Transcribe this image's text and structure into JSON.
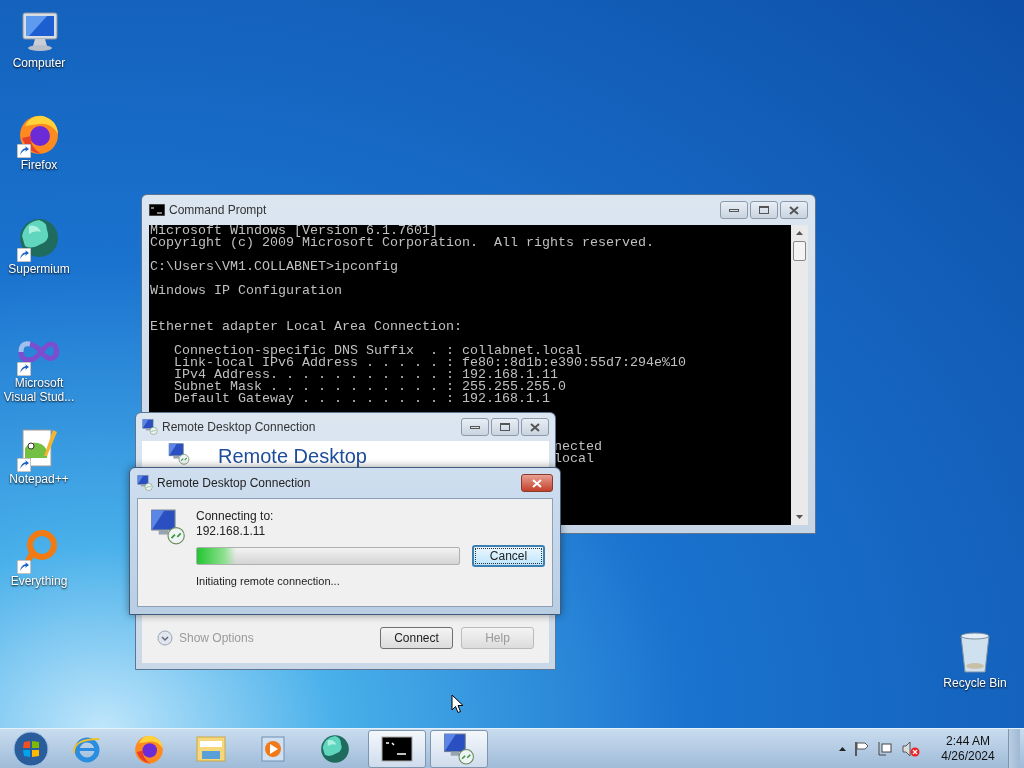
{
  "desktop_icons": [
    {
      "label": "Computer",
      "shortcut": false
    },
    {
      "label": "Firefox",
      "shortcut": true
    },
    {
      "label": "Supermium",
      "shortcut": true
    },
    {
      "label": "Microsoft Visual Stud...",
      "shortcut": true
    },
    {
      "label": "Notepad++",
      "shortcut": true
    },
    {
      "label": "Everything",
      "shortcut": true
    },
    {
      "label": "Recycle Bin",
      "shortcut": false
    }
  ],
  "console_window": {
    "title": "Command Prompt",
    "blocks": [
      [
        "Microsoft Windows [Version 6.1.7601]",
        "Copyright (c) 2009 Microsoft Corporation.  All rights reserved."
      ],
      [
        "C:\\Users\\VM1.COLLABNET>ipconfig"
      ],
      [
        "Windows IP Configuration"
      ],
      [
        "Ethernet adapter Local Area Connection:"
      ],
      [
        "Connection-specific DNS Suffix  . : collabnet.local",
        "Link-local IPv6 Address . . . . . : fe80::8d1b:e390:55d7:294e%10",
        "IPv4 Address. . . . . . . . . . . : 192.168.1.11",
        "Subnet Mask . . . . . . . . . . . : 255.255.255.0",
        "Default Gateway . . . . . . . . . : 192.168.1.1"
      ]
    ],
    "partial_lines": [
      "nected",
      "local"
    ]
  },
  "rdc_window": {
    "title": "Remote Desktop Connection",
    "heading": "Remote Desktop",
    "show_options": {
      "label": "Show Options",
      "disabled": true
    },
    "buttons": [
      {
        "label": "Connect",
        "disabled": false
      },
      {
        "label": "Help",
        "disabled": true
      }
    ]
  },
  "connecting_dialog": {
    "title": "Remote Desktop Connection",
    "label": "Connecting to:",
    "address": "192.168.1.11",
    "progress": {
      "level": 0.15
    },
    "status": "Initiating remote connection...",
    "buttons": [
      {
        "label": "Cancel",
        "focused": true
      }
    ]
  },
  "taskbar": {
    "items": [
      {
        "open": false
      },
      {
        "open": false
      },
      {
        "open": false
      },
      {
        "open": false
      },
      {
        "open": false
      },
      {
        "open": true
      },
      {
        "open": true
      }
    ],
    "clock": {
      "time": "2:44 AM",
      "date": "4/26/2024"
    }
  }
}
